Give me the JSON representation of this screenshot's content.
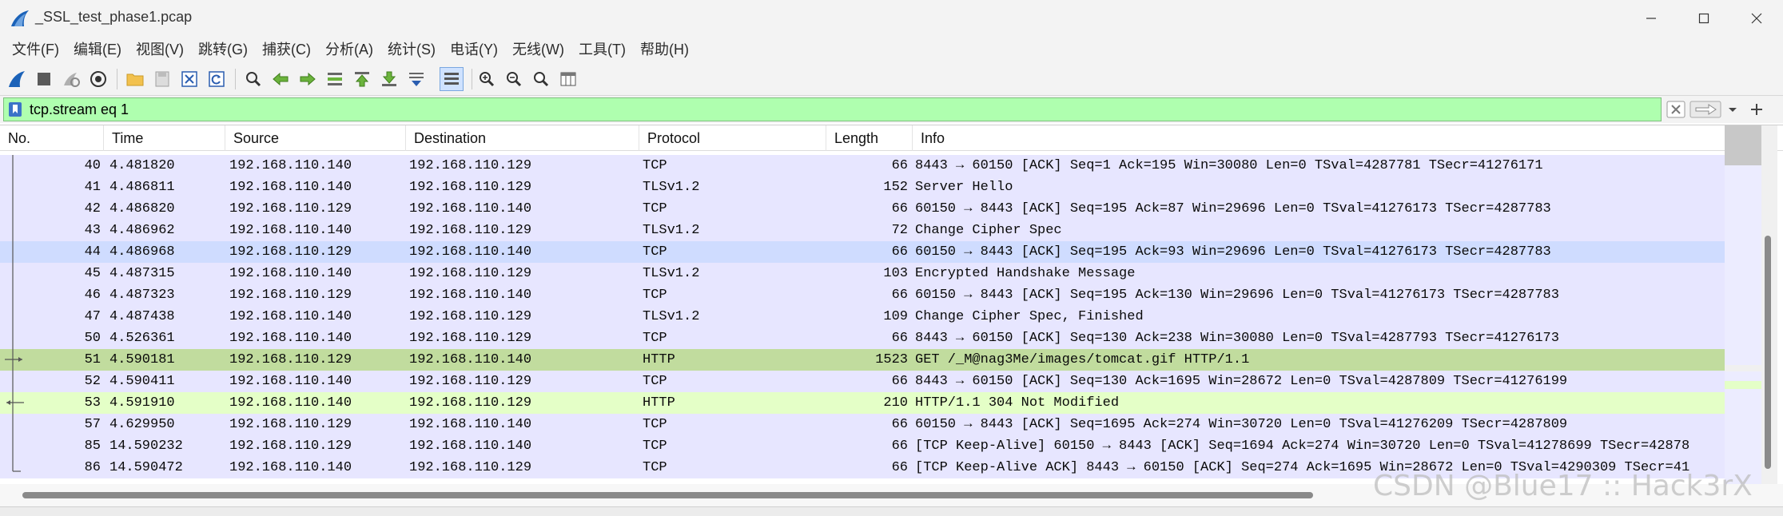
{
  "window": {
    "title": "_SSL_test_phase1.pcap"
  },
  "menu": [
    "文件(F)",
    "编辑(E)",
    "视图(V)",
    "跳转(G)",
    "捕获(C)",
    "分析(A)",
    "统计(S)",
    "电话(Y)",
    "无线(W)",
    "工具(T)",
    "帮助(H)"
  ],
  "toolbar": {
    "icons": [
      "shark-fin-start-icon",
      "stop-icon",
      "restart-icon",
      "capture-options-icon",
      "open-file-icon",
      "save-file-icon",
      "close-file-icon",
      "reload-icon",
      "find-packet-icon",
      "go-back-icon",
      "go-forward-icon",
      "go-to-packet-icon",
      "first-packet-icon",
      "last-packet-icon",
      "autoscroll-icon",
      "colorize-icon",
      "zoom-in-icon",
      "zoom-out-icon",
      "normal-size-icon",
      "resize-columns-icon"
    ]
  },
  "filter": {
    "value": "tcp.stream eq 1",
    "valid_color": "#afffaf"
  },
  "columns": [
    "No.",
    "Time",
    "Source",
    "Destination",
    "Protocol",
    "Length",
    "Info"
  ],
  "rows": [
    {
      "no": "40",
      "time": "4.481820",
      "src": "192.168.110.140",
      "dst": "192.168.110.129",
      "proto": "TCP",
      "len": "66",
      "info": "8443 → 60150 [ACK] Seq=1 Ack=195 Win=30080 Len=0 TSval=4287781 TSecr=41276171",
      "bg": "#e7e6ff",
      "mark": "bracket-mid"
    },
    {
      "no": "41",
      "time": "4.486811",
      "src": "192.168.110.140",
      "dst": "192.168.110.129",
      "proto": "TLSv1.2",
      "len": "152",
      "info": "Server Hello",
      "bg": "#e7e6ff",
      "mark": "bracket-mid"
    },
    {
      "no": "42",
      "time": "4.486820",
      "src": "192.168.110.129",
      "dst": "192.168.110.140",
      "proto": "TCP",
      "len": "66",
      "info": "60150 → 8443 [ACK] Seq=195 Ack=87 Win=29696 Len=0 TSval=41276173 TSecr=4287783",
      "bg": "#e7e6ff",
      "mark": "bracket-mid"
    },
    {
      "no": "43",
      "time": "4.486962",
      "src": "192.168.110.140",
      "dst": "192.168.110.129",
      "proto": "TLSv1.2",
      "len": "72",
      "info": "Change Cipher Spec",
      "bg": "#e7e6ff",
      "mark": "bracket-mid"
    },
    {
      "no": "44",
      "time": "4.486968",
      "src": "192.168.110.129",
      "dst": "192.168.110.140",
      "proto": "TCP",
      "len": "66",
      "info": "60150 → 8443 [ACK] Seq=195 Ack=93 Win=29696 Len=0 TSval=41276173 TSecr=4287783",
      "bg": "#cfdcff",
      "mark": "bracket-mid"
    },
    {
      "no": "45",
      "time": "4.487315",
      "src": "192.168.110.140",
      "dst": "192.168.110.129",
      "proto": "TLSv1.2",
      "len": "103",
      "info": "Encrypted Handshake Message",
      "bg": "#e7e6ff",
      "mark": "bracket-mid"
    },
    {
      "no": "46",
      "time": "4.487323",
      "src": "192.168.110.129",
      "dst": "192.168.110.140",
      "proto": "TCP",
      "len": "66",
      "info": "60150 → 8443 [ACK] Seq=195 Ack=130 Win=29696 Len=0 TSval=41276173 TSecr=4287783",
      "bg": "#e7e6ff",
      "mark": "bracket-mid"
    },
    {
      "no": "47",
      "time": "4.487438",
      "src": "192.168.110.140",
      "dst": "192.168.110.129",
      "proto": "TLSv1.2",
      "len": "109",
      "info": "Change Cipher Spec, Finished",
      "bg": "#e7e6ff",
      "mark": "bracket-mid"
    },
    {
      "no": "50",
      "time": "4.526361",
      "src": "192.168.110.140",
      "dst": "192.168.110.129",
      "proto": "TCP",
      "len": "66",
      "info": "8443 → 60150 [ACK] Seq=130 Ack=238 Win=30080 Len=0 TSval=4287793 TSecr=41276173",
      "bg": "#e7e6ff",
      "mark": "bracket-mid"
    },
    {
      "no": "51",
      "time": "4.590181",
      "src": "192.168.110.129",
      "dst": "192.168.110.140",
      "proto": "HTTP",
      "len": "1523",
      "info": "GET /_M@nag3Me/images/tomcat.gif HTTP/1.1",
      "bg": "#c1dc9e",
      "mark": "arrow-right"
    },
    {
      "no": "52",
      "time": "4.590411",
      "src": "192.168.110.140",
      "dst": "192.168.110.129",
      "proto": "TCP",
      "len": "66",
      "info": "8443 → 60150 [ACK] Seq=130 Ack=1695 Win=28672 Len=0 TSval=4287809 TSecr=41276199",
      "bg": "#e7e6ff",
      "mark": "bracket-mid"
    },
    {
      "no": "53",
      "time": "4.591910",
      "src": "192.168.110.140",
      "dst": "192.168.110.129",
      "proto": "HTTP",
      "len": "210",
      "info": "HTTP/1.1 304 Not Modified",
      "bg": "#e4ffc7",
      "mark": "arrow-left"
    },
    {
      "no": "57",
      "time": "4.629950",
      "src": "192.168.110.129",
      "dst": "192.168.110.140",
      "proto": "TCP",
      "len": "66",
      "info": "60150 → 8443 [ACK] Seq=1695 Ack=274 Win=30720 Len=0 TSval=41276209 TSecr=4287809",
      "bg": "#e7e6ff",
      "mark": "bracket-mid"
    },
    {
      "no": "85",
      "time": "14.590232",
      "src": "192.168.110.129",
      "dst": "192.168.110.140",
      "proto": "TCP",
      "len": "66",
      "info": "[TCP Keep-Alive] 60150 → 8443 [ACK] Seq=1694 Ack=274 Win=30720 Len=0 TSval=41278699 TSecr=42878",
      "bg": "#e7e6ff",
      "mark": "bracket-mid"
    },
    {
      "no": "86",
      "time": "14.590472",
      "src": "192.168.110.140",
      "dst": "192.168.110.129",
      "proto": "TCP",
      "len": "66",
      "info": "[TCP Keep-Alive ACK] 8443 → 60150 [ACK] Seq=274 Ack=1695 Win=28672 Len=0 TSval=4290309 TSecr=41",
      "bg": "#e7e6ff",
      "mark": "bracket-end"
    }
  ],
  "watermark": "CSDN @Blue17 :: Hack3rX"
}
